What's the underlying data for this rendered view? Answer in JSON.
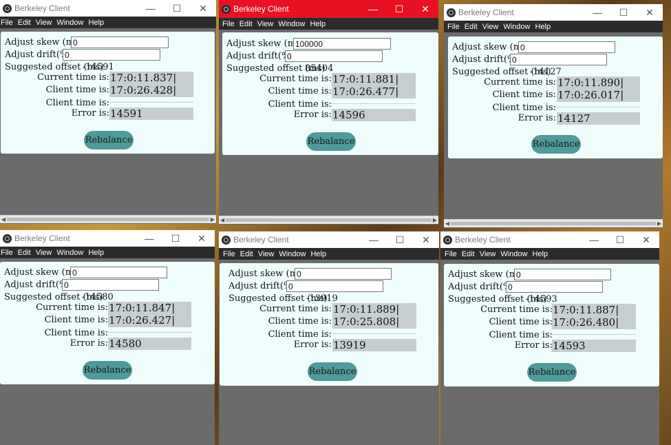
{
  "app": {
    "title": "Berkeley Client",
    "menu": [
      "File",
      "Edit",
      "View",
      "Window",
      "Help"
    ],
    "controls": {
      "minimize": "—",
      "maximize": "☐",
      "close": "✕"
    },
    "labels": {
      "skew": "Adjust skew (ms)",
      "drift": "Adjust drift(%)",
      "suggested": "Suggested offset (ms)",
      "current": "Current time is:",
      "client": "Client time is:",
      "client_empty": "Client time is:",
      "error": "Error is:",
      "rebalance": "Rebalance"
    },
    "accent_active": "#e81123"
  },
  "windows": [
    {
      "skew": "0",
      "drift": "0",
      "offset": "-14591",
      "current_time": "17:0:11.837|",
      "client_time": "17:0:26.428|",
      "error": "14591"
    },
    {
      "skew": "100000",
      "drift": "0",
      "offset": "85404",
      "current_time": "17:0:11.881|",
      "client_time": "17:0:26.477|",
      "error": "14596"
    },
    {
      "skew": "0",
      "drift": "0",
      "offset": "-14127",
      "current_time": "17:0:11.890|",
      "client_time": "17:0:26.017|",
      "error": "14127"
    },
    {
      "skew": "0",
      "drift": "0",
      "offset": "-14580",
      "current_time": "17:0:11.847|",
      "client_time": "17:0:26.427|",
      "error": "14580"
    },
    {
      "skew": "0",
      "drift": "0",
      "offset": "-13919",
      "current_time": "17:0:11.889|",
      "client_time": "17:0:25.808|",
      "error": "13919"
    },
    {
      "skew": "0",
      "drift": "0",
      "offset": "-14593",
      "current_time": "17:0:11.887|",
      "client_time": "17:0:26.480|",
      "error": "14593"
    }
  ]
}
